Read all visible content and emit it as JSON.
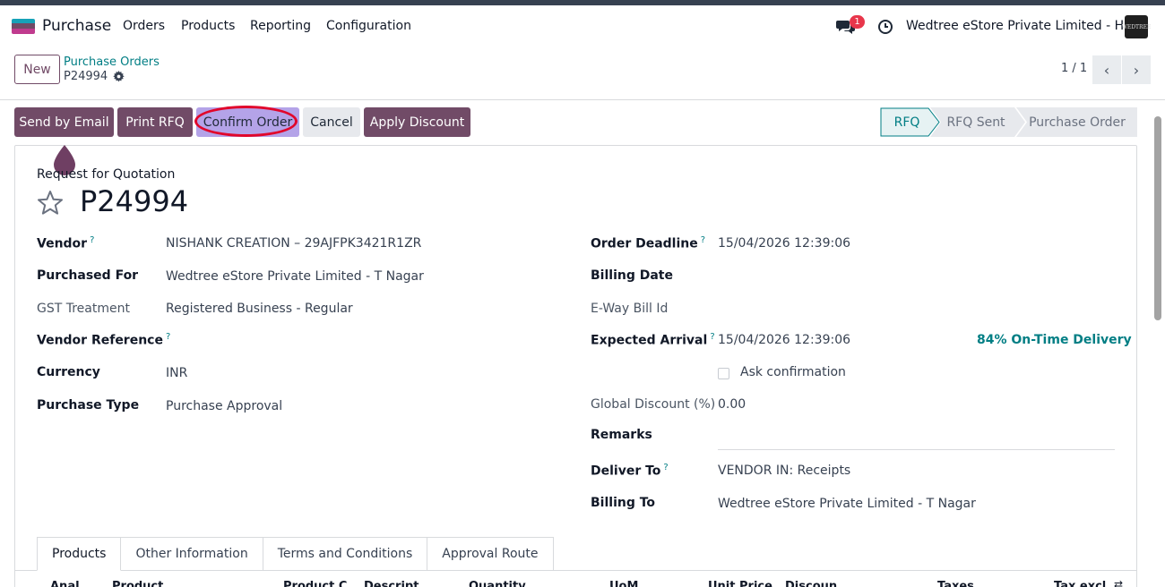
{
  "navbar": {
    "app_name": "Purchase",
    "menu": [
      "Orders",
      "Products",
      "Reporting",
      "Configuration"
    ],
    "chat_count": "1",
    "company": "Wedtree eStore Private Limited - HO",
    "avatar_text": "WEDTREE"
  },
  "control_panel": {
    "new_label": "New",
    "breadcrumb_parent": "Purchase Orders",
    "breadcrumb_current": "P24994",
    "pager": "1 / 1"
  },
  "actions": {
    "send_email": "Send by Email",
    "print_rfq": "Print RFQ",
    "confirm_order": "Confirm Order",
    "cancel": "Cancel",
    "apply_discount": "Apply Discount"
  },
  "statusbar": [
    "RFQ",
    "RFQ Sent",
    "Purchase Order"
  ],
  "form": {
    "subtitle": "Request for Quotation",
    "name": "P24994",
    "vendor_label": "Vendor",
    "vendor": "NISHANK CREATION – 29AJFPK3421R1ZR",
    "purchased_for_label": "Purchased For",
    "purchased_for": "Wedtree eStore Private Limited - T Nagar",
    "gst_label": "GST Treatment",
    "gst": "Registered Business - Regular",
    "vendor_ref_label": "Vendor Reference",
    "currency_label": "Currency",
    "currency": "INR",
    "purchase_type_label": "Purchase Type",
    "purchase_type": "Purchase Approval",
    "order_deadline_label": "Order Deadline",
    "order_deadline": "15/04/2026 12:39:06",
    "billing_date_label": "Billing Date",
    "eway_label": "E-Way Bill Id",
    "expected_arrival_label": "Expected Arrival",
    "expected_arrival": "15/04/2026 12:39:06",
    "on_time": "84% On-Time Delivery",
    "ask_confirmation": "Ask confirmation",
    "global_discount_label": "Global Discount (%)",
    "global_discount": "0.00",
    "remarks_label": "Remarks",
    "deliver_to_label": "Deliver To",
    "deliver_to": "VENDOR IN: Receipts",
    "billing_to_label": "Billing To",
    "billing_to": "Wedtree eStore Private Limited - T Nagar",
    "help_mark": "?"
  },
  "tabs": [
    "Products",
    "Other Information",
    "Terms and Conditions",
    "Approval Route"
  ],
  "table_columns": [
    "Anal",
    "Product",
    "Product C",
    "Descript",
    "Quantity",
    "UoM",
    "Unit Price",
    "Discoun",
    "Taxes",
    "Tax excl."
  ],
  "colors": {
    "primary": "#714b67",
    "link": "#017e84",
    "highlight": "#e1062b",
    "confirm_bg": "#b4a3e8"
  }
}
